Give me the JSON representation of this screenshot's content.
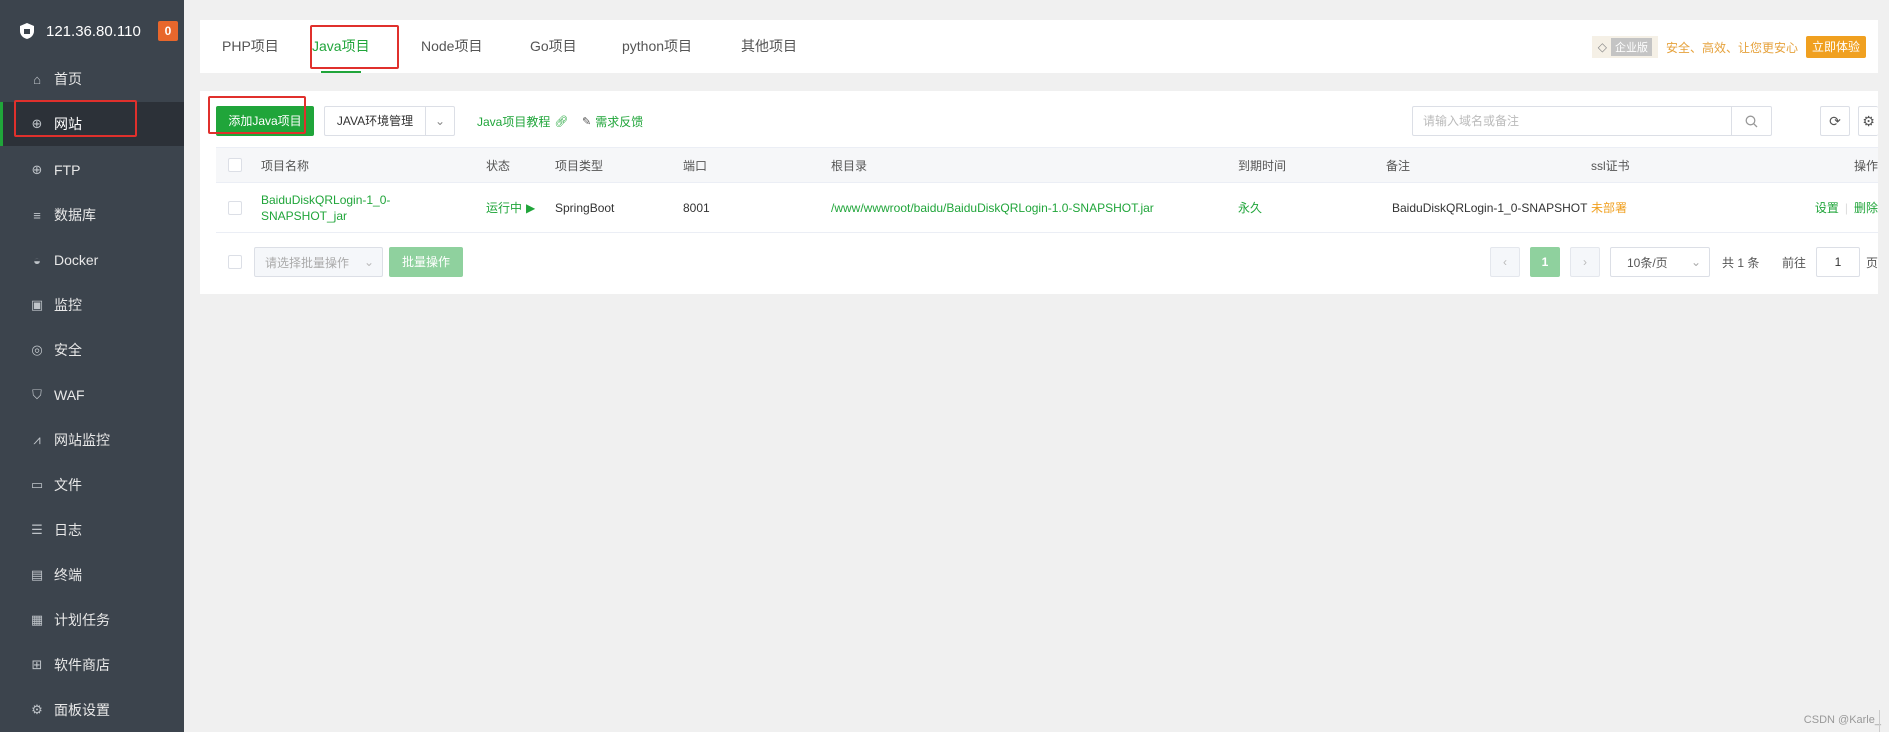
{
  "sidebar": {
    "server_ip": "121.36.80.110",
    "badge": "0",
    "items": [
      {
        "label": "首页",
        "icon": "home-icon"
      },
      {
        "label": "网站",
        "icon": "globe-icon",
        "active": true
      },
      {
        "label": "FTP",
        "icon": "ftp-icon"
      },
      {
        "label": "数据库",
        "icon": "database-icon"
      },
      {
        "label": "Docker",
        "icon": "docker-icon"
      },
      {
        "label": "监控",
        "icon": "monitor-icon"
      },
      {
        "label": "安全",
        "icon": "shield-icon"
      },
      {
        "label": "WAF",
        "icon": "waf-icon"
      },
      {
        "label": "网站监控",
        "icon": "chart-icon"
      },
      {
        "label": "文件",
        "icon": "folder-icon"
      },
      {
        "label": "日志",
        "icon": "log-icon"
      },
      {
        "label": "终端",
        "icon": "terminal-icon"
      },
      {
        "label": "计划任务",
        "icon": "calendar-icon"
      },
      {
        "label": "软件商店",
        "icon": "apps-icon"
      },
      {
        "label": "面板设置",
        "icon": "gear-icon"
      }
    ]
  },
  "tabs": [
    {
      "label": "PHP项目"
    },
    {
      "label": "Java项目",
      "active": true
    },
    {
      "label": "Node项目"
    },
    {
      "label": "Go项目"
    },
    {
      "label": "python项目"
    },
    {
      "label": "其他项目"
    }
  ],
  "promo": {
    "enterprise": "企业版",
    "slogan": "安全、高效、让您更安心",
    "try_button": "立即体验"
  },
  "toolbar": {
    "add_button": "添加Java项目",
    "env_button": "JAVA环境管理",
    "tutorial_link": "Java项目教程",
    "feedback_link": "需求反馈",
    "search_placeholder": "请输入域名或备注"
  },
  "table": {
    "headers": {
      "name": "项目名称",
      "status": "状态",
      "type": "项目类型",
      "port": "端口",
      "root": "根目录",
      "expire": "到期时间",
      "remark": "备注",
      "ssl": "ssl证书",
      "ops": "操作"
    },
    "rows": [
      {
        "name": "BaiduDiskQRLogin-1_0-SNAPSHOT_jar",
        "status": "运行中",
        "type": "SpringBoot",
        "port": "8001",
        "root": "/www/wwwroot/baidu/BaiduDiskQRLogin-1.0-SNAPSHOT.jar",
        "expire": "永久",
        "remark": "BaiduDiskQRLogin-1_0-SNAPSHOT",
        "ssl": "未部署",
        "op_settings": "设置",
        "op_delete": "删除"
      }
    ]
  },
  "bottom": {
    "batch_placeholder": "请选择批量操作",
    "batch_button": "批量操作",
    "current_page": "1",
    "page_size": "10条/页",
    "total": "共 1 条",
    "goto_label": "前往",
    "goto_value": "1",
    "page_suffix": "页"
  },
  "watermark": "CSDN @Karle_"
}
